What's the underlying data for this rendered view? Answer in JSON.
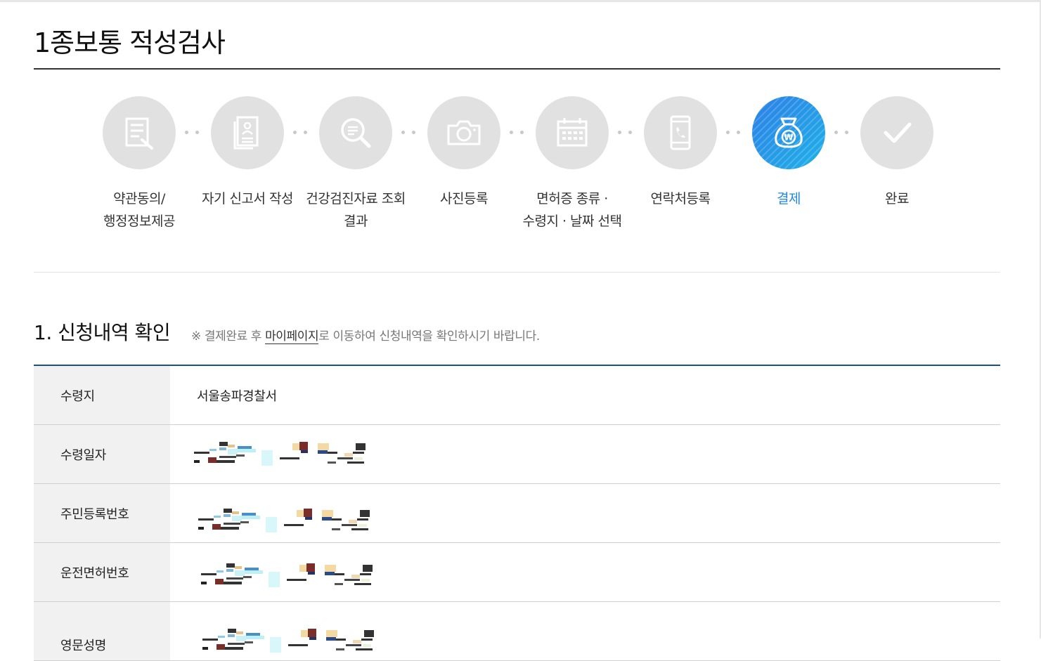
{
  "page": {
    "title": "1종보통 적성검사"
  },
  "steps": [
    {
      "label": "약관동의/\n행정정보제공",
      "icon": "document-pen-icon",
      "active": false
    },
    {
      "label": "자기 신고서 작성",
      "icon": "profile-document-icon",
      "active": false
    },
    {
      "label": "건강검진자료 조회\n결과",
      "icon": "search-document-icon",
      "active": false
    },
    {
      "label": "사진등록",
      "icon": "camera-icon",
      "active": false
    },
    {
      "label": "면허증 종류 ·\n수령지 · 날짜 선택",
      "icon": "calendar-icon",
      "active": false
    },
    {
      "label": "연락처등록",
      "icon": "phone-icon",
      "active": false
    },
    {
      "label": "결제",
      "icon": "won-bag-icon",
      "active": true
    },
    {
      "label": "완료",
      "icon": "check-icon",
      "active": false
    }
  ],
  "section": {
    "title": "1. 신청내역 확인",
    "note_prefix": "※ 결제완료 후 ",
    "note_link": "마이페이지",
    "note_suffix": "로 이동하여 신청내역을 확인하시기 바랍니다."
  },
  "table": {
    "rows": [
      {
        "label": "수령지",
        "value": "서울송파경찰서",
        "redacted": false
      },
      {
        "label": "수령일자",
        "value": "",
        "redacted": true
      },
      {
        "label": "주민등록번호",
        "value": "",
        "redacted": true
      },
      {
        "label": "운전면허번호",
        "value": "",
        "redacted": true
      },
      {
        "label": "영문성명",
        "value": "",
        "redacted": true
      }
    ]
  },
  "colors": {
    "accent": "#1f88e0",
    "step_inactive": "#e1e1e1",
    "table_top_border": "#1e4f8a",
    "table_header_bg": "#f1f1f1"
  }
}
